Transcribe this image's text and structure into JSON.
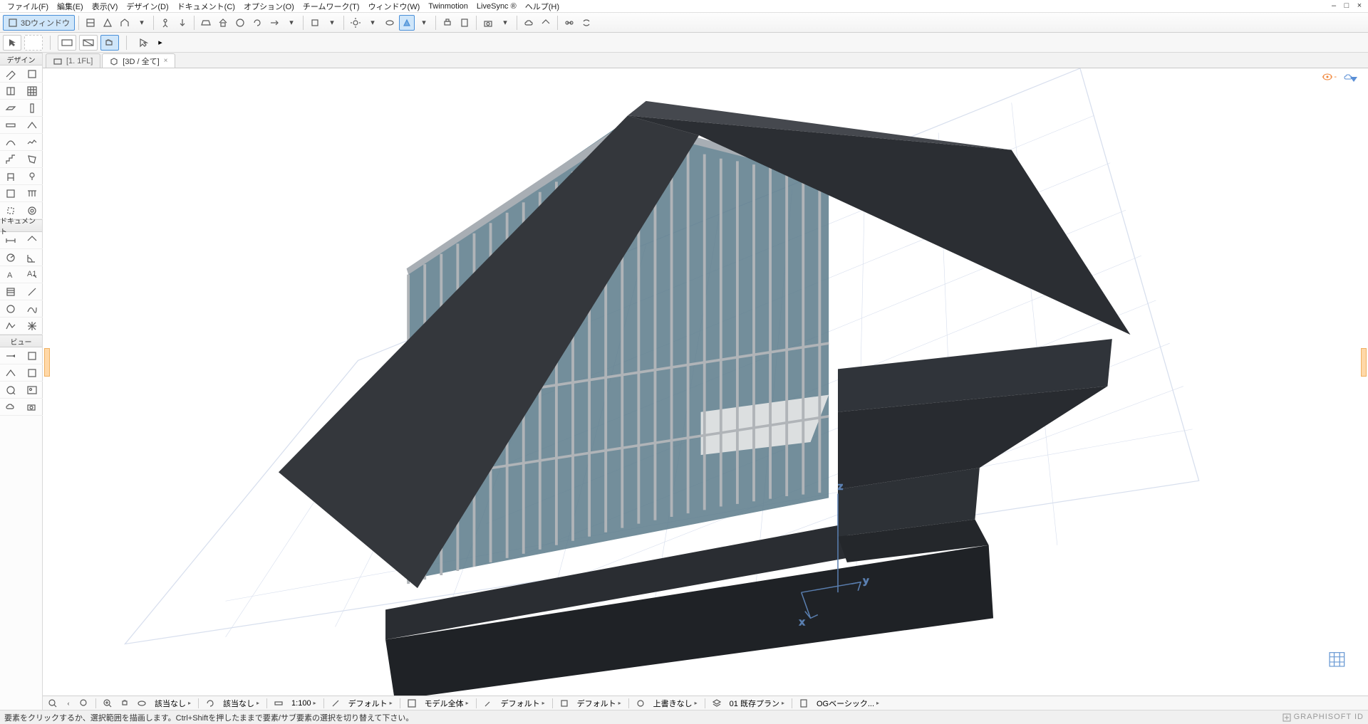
{
  "menubar": {
    "items": [
      "ファイル(F)",
      "編集(E)",
      "表示(V)",
      "デザイン(D)",
      "ドキュメント(C)",
      "オプション(O)",
      "チームワーク(T)",
      "ウィンドウ(W)",
      "Twinmotion",
      "LiveSync ®",
      "ヘルプ(H)"
    ]
  },
  "main_toolbar": {
    "window_label": "3Dウィンドウ"
  },
  "tabs": [
    {
      "label": "[1. 1FL]",
      "closable": false,
      "icon": "folder"
    },
    {
      "label": "[3D / 全て]",
      "closable": true,
      "icon": "cube"
    }
  ],
  "hint_overlay": {
    "left": "----",
    "right_icon": "eye"
  },
  "toolbox": {
    "sections": [
      "デザイン",
      "ドキュメント",
      "ビュー"
    ]
  },
  "footer": {
    "na1": "該当なし",
    "na2": "該当なし",
    "scale": "1:100",
    "display": "デフォルト",
    "model": "モデル全体",
    "renov": "デフォルト",
    "ps": "デフォルト",
    "override": "上書きなし",
    "layer": "01 既存プラン",
    "mvo": "OGベーシック..."
  },
  "statusbar": {
    "message": "要素をクリックするか、選択範囲を描画します。Ctrl+Shiftを押したままで要素/サブ要素の選択を切り替えて下さい。",
    "brand": "GRAPHISOFT ID"
  },
  "window_controls": {
    "min": "–",
    "max": "□",
    "close": "×"
  }
}
